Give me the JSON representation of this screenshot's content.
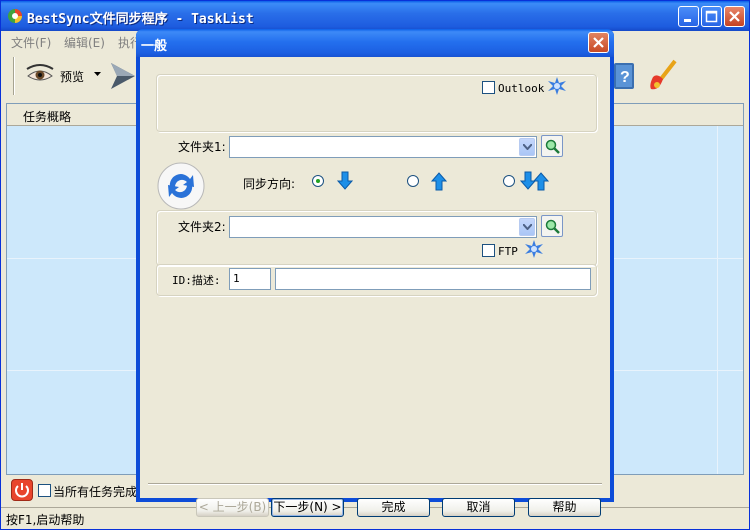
{
  "main_window": {
    "title": "BestSync文件同步程序 - TaskList",
    "menu": [
      "文件(F)",
      "编辑(E)",
      "执行"
    ],
    "toolbar": {
      "preview_label": "预览"
    },
    "task_panel": {
      "column_header": "任务概略"
    },
    "bottom": {
      "checkbox_label": "当所有任务完成"
    },
    "status_text": "按F1,启动帮助"
  },
  "dialog": {
    "title": "一般",
    "outlook_label": "Outlook",
    "folder1_label": "文件夹1:",
    "folder1_value": "",
    "sync_direction_label": "同步方向:",
    "folder2_label": "文件夹2:",
    "folder2_value": "",
    "ftp_label": "FTP",
    "id_label": "ID:描述:",
    "id_value": "1",
    "description_value": "",
    "buttons": {
      "prev": "< 上一步(B)",
      "next": "下一步(N) >",
      "finish": "完成",
      "cancel": "取消",
      "help": "帮助"
    }
  },
  "colors": {
    "title_blue": "#0a5fe8",
    "panel_bg": "#ece9d8",
    "list_bg": "#cde8fb",
    "arrow_blue": "#1d8fe8"
  }
}
